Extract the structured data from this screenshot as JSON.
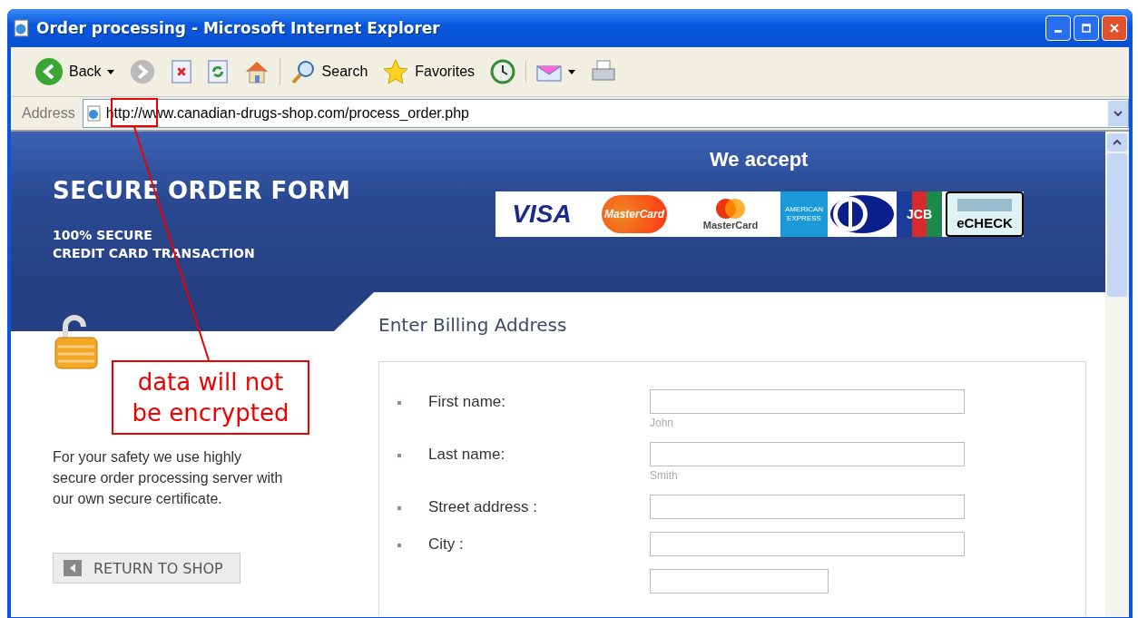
{
  "window": {
    "title": "Order processing - Microsoft Internet Explorer"
  },
  "toolbar": [
    {
      "kind": "back",
      "label": "Back"
    },
    {
      "kind": "forward"
    },
    {
      "kind": "stop"
    },
    {
      "kind": "refresh"
    },
    {
      "kind": "home"
    },
    {
      "kind": "search",
      "label": "Search"
    },
    {
      "kind": "favorites",
      "label": "Favorites"
    },
    {
      "kind": "history"
    },
    {
      "kind": "mail"
    },
    {
      "kind": "print"
    }
  ],
  "address_bar": {
    "label": "Address",
    "url_scheme": "http://",
    "url_rest": "www.canadian-drugs-shop.com/process_order.php"
  },
  "page": {
    "title": "SECURE ORDER FORM",
    "subtitle_lines": [
      "100% SECURE",
      "CREDIT CARD TRANSACTION"
    ],
    "accept_heading": "We accept",
    "cards": [
      {
        "kind": "visa",
        "text": "VISA"
      },
      {
        "kind": "mastercard",
        "text": "MasterCard"
      },
      {
        "kind": "mastercard_classic",
        "text": "MasterCard"
      },
      {
        "kind": "amex",
        "text": "AMERICAN EXPRESS"
      },
      {
        "kind": "diners"
      },
      {
        "kind": "jcb",
        "text": "JCB"
      },
      {
        "kind": "echeck",
        "text": "eCHECK"
      }
    ],
    "safety_text": "For your safety we use highly secure order processing server with our own secure certificate.",
    "return_button": "RETURN TO SHOP",
    "form_heading": "Enter Billing Address",
    "fields": [
      {
        "label": "First name:",
        "hint": "John"
      },
      {
        "label": "Last name:",
        "hint": "Smith"
      },
      {
        "label": "Street address :"
      },
      {
        "label": "City :"
      },
      {
        "kind": "short"
      }
    ]
  },
  "annotation": {
    "text_lines": [
      "data will not",
      "be encrypted"
    ]
  }
}
